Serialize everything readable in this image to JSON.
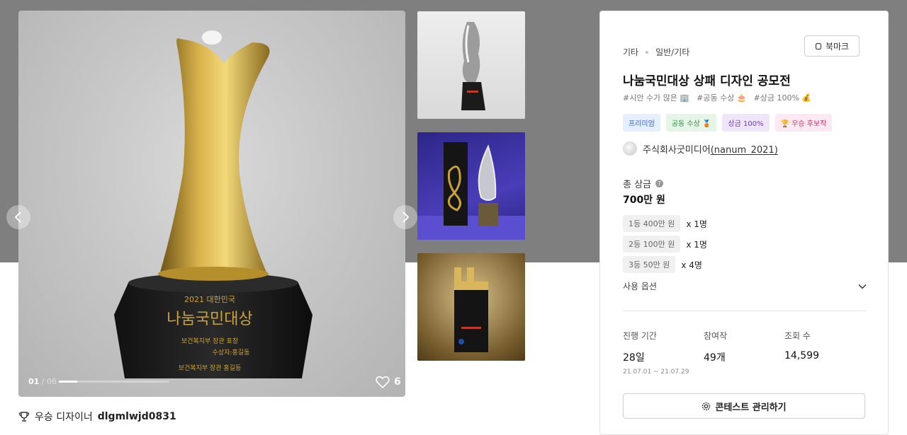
{
  "gallery": {
    "current": "01",
    "total": "/ 06",
    "progress": 0.17,
    "likes": "6",
    "trophy_text_line1": "2021 대한민국",
    "trophy_text_line2": "나눔국민대상",
    "trophy_text_line3": "보건복지부 장관 표창",
    "trophy_text_line4": "수상자:홍길동",
    "trophy_text_line5": "보건복지부 장관 홍길동",
    "prev_icon": "chevron-left-icon",
    "next_icon": "chevron-right-icon"
  },
  "winner": {
    "label": "우승 디자이너",
    "id": "dlgmlwjd0831"
  },
  "contest": {
    "category": "기타",
    "subcategory": "일반/기타",
    "bookmark_label": "북마크",
    "title": "나눔국민대상 상패 디자인 공모전",
    "hashtags": [
      "#시안 수가 많은 🏢",
      "#공동 수상 🎂",
      "#상금 100% 💰"
    ],
    "badges": [
      "프리미엄",
      "공동 수상 🥉",
      "상금 100%",
      "🏆 우승 후보작"
    ],
    "host_name": "주식회사굿미디어",
    "host_id": "(nanum_2021)"
  },
  "prize": {
    "label": "총 상금",
    "help_icon": "?",
    "total": "700만 원",
    "rows": [
      {
        "tag": "1등 400만 원",
        "count": "x 1명"
      },
      {
        "tag": "2등 100만 원",
        "count": "x 1명"
      },
      {
        "tag": "3등 50만 원",
        "count": "x 4명"
      }
    ],
    "options_label": "사용 옵션"
  },
  "stats": {
    "period_label": "진행 기간",
    "period_value": "28일",
    "period_range": "21.07.01 ~ 21.07.29",
    "entries_label": "참여작",
    "entries_value": "49개",
    "views_label": "조회 수",
    "views_value": "14,599"
  },
  "manage_label": "콘테스트 관리하기",
  "colors": {
    "gold": "#c9a23a",
    "dark_base": "#1c1c1c",
    "purple_bg": "#3b2f9e"
  }
}
